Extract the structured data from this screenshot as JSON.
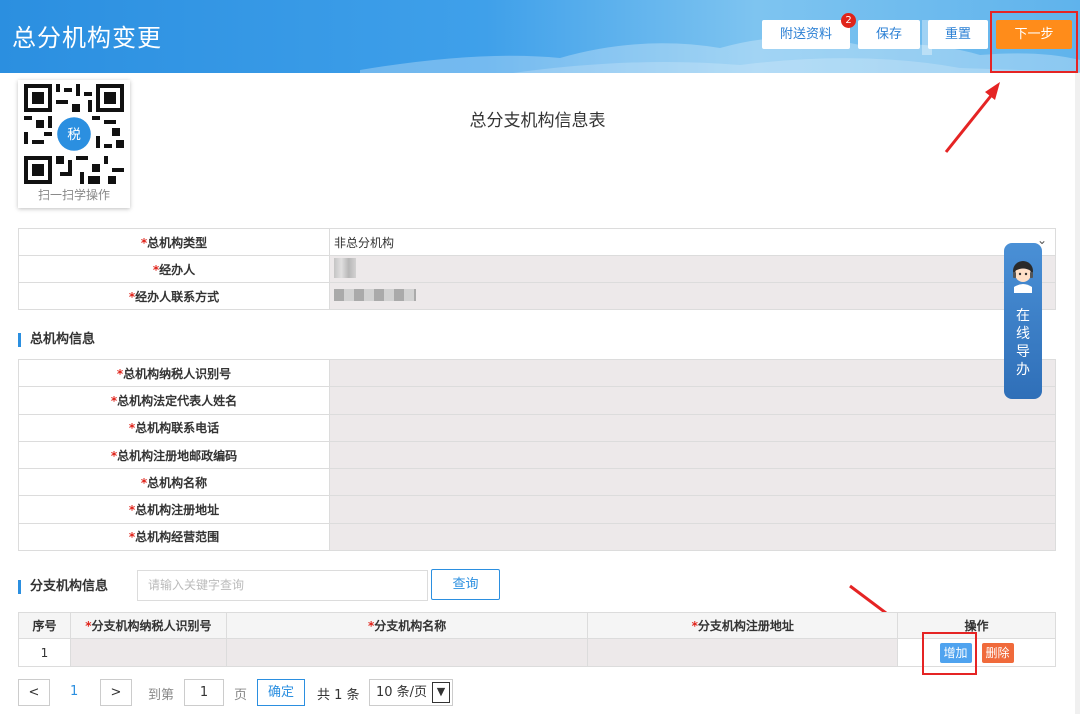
{
  "header": {
    "title": "总分机构变更",
    "buttons": {
      "attach": "附送资料",
      "attach_badge": "2",
      "save": "保存",
      "reset": "重置",
      "next": "下一步"
    }
  },
  "qr": {
    "caption": "扫一扫学操作",
    "icon": "qr-code-icon"
  },
  "form_title": "总分支机构信息表",
  "basic": {
    "rows": [
      {
        "label": "总机构类型",
        "value": "非总分机构"
      },
      {
        "label": "经办人",
        "value": ""
      },
      {
        "label": "经办人联系方式",
        "value": ""
      }
    ]
  },
  "head_office": {
    "section_title": "总机构信息",
    "rows": [
      {
        "label": "总机构纳税人识别号"
      },
      {
        "label": "总机构法定代表人姓名"
      },
      {
        "label": "总机构联系电话"
      },
      {
        "label": "总机构注册地邮政编码"
      },
      {
        "label": "总机构名称"
      },
      {
        "label": "总机构注册地址"
      },
      {
        "label": "总机构经营范围"
      }
    ]
  },
  "branch": {
    "section_title": "分支机构信息",
    "search_placeholder": "请输入关键字查询",
    "search_button": "查询",
    "columns": [
      "序号",
      "分支机构纳税人识别号",
      "分支机构名称",
      "分支机构注册地址",
      "操作"
    ],
    "rows": [
      {
        "index": "1"
      }
    ],
    "add_label": "增加",
    "delete_label": "删除"
  },
  "pagination": {
    "prev": "<",
    "current_page": "1",
    "next": ">",
    "goto_label": "到第",
    "goto_value": "1",
    "page_unit": "页",
    "confirm": "确定",
    "total": "共 1 条",
    "page_size": "10 条/页"
  },
  "helper": {
    "label": [
      "在",
      "线",
      "导",
      "办"
    ]
  },
  "colors": {
    "primary": "#2b8fe0",
    "next_button": "#ff8c1a",
    "required": "#e0241b",
    "highlight_box": "#e52424"
  }
}
